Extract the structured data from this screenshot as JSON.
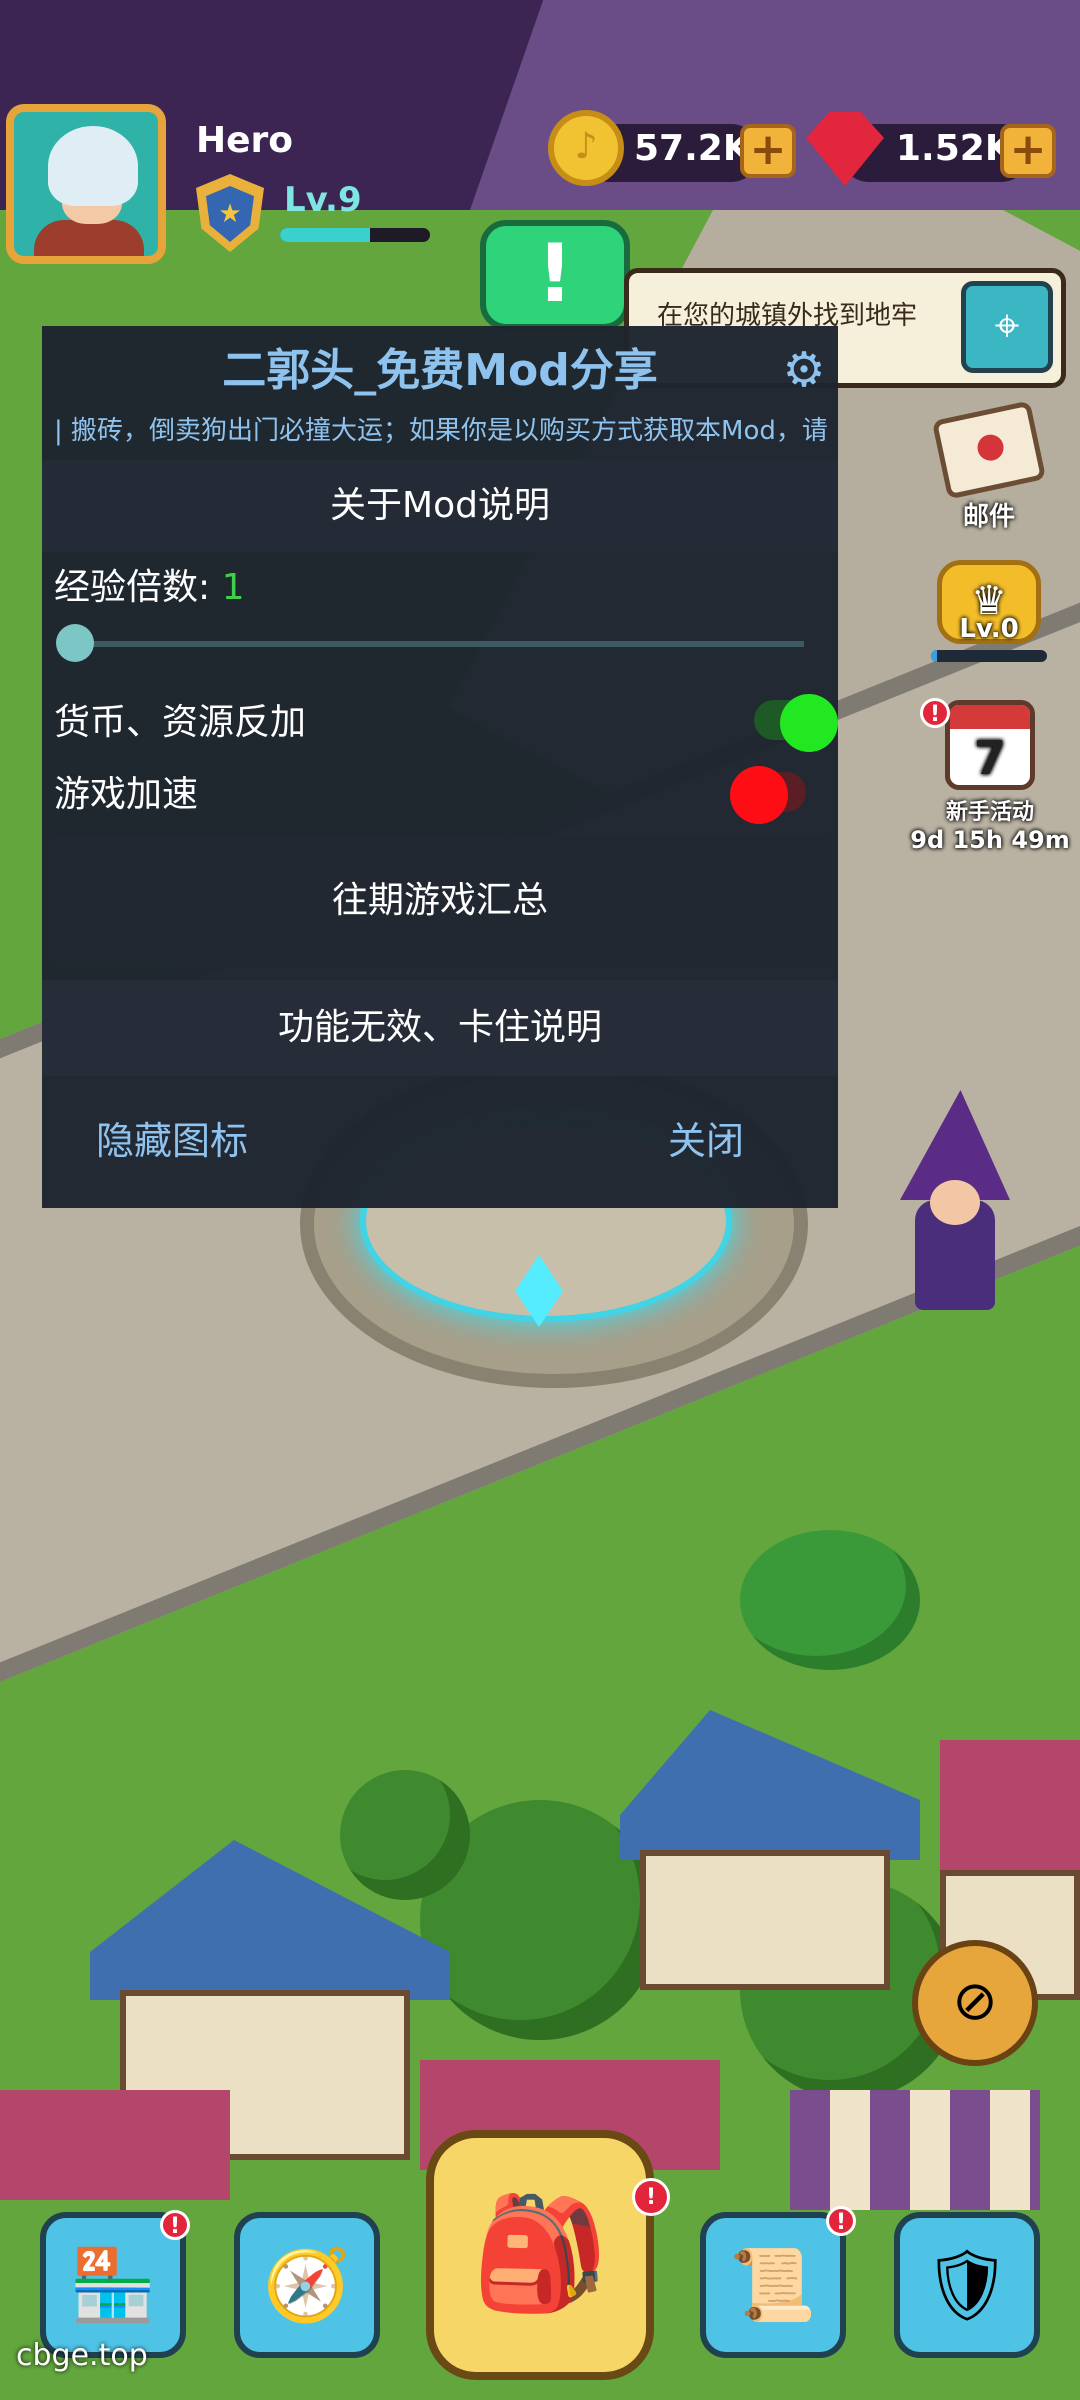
{
  "hud": {
    "player_name": "Hero",
    "level": "Lv.9",
    "level_progress": 0.6,
    "coins": "57.2K",
    "gems": "1.52K",
    "plus": "+",
    "alert_glyph": "!",
    "quest_text": "在您的城镇外找到地牢",
    "shield_glyph": "★",
    "coin_glyph": "♪",
    "map_glyph": "⌖"
  },
  "side": {
    "mail_label": "邮件",
    "crown_level": "Lv.0",
    "crown_glyph": "♛",
    "crown_progress": 0.05,
    "event_day": "7",
    "event_label": "新手活动",
    "event_timer": "9d 15h 49m",
    "badge": "!"
  },
  "mod": {
    "title": "二郭头_免费Mod分享",
    "gear_glyph": "⚙",
    "marquee": "| 搬砖，倒卖狗出门必撞大运；如果你是以购买方式获取本Mod，请",
    "about_button": "关于Mod说明",
    "exp_label": "经验倍数: ",
    "exp_value": "1",
    "exp_multiplier_value": 1,
    "toggle_currency": "货币、资源反加",
    "toggle_currency_on": true,
    "toggle_speed": "游戏加速",
    "toggle_speed_on": false,
    "games_button": "往期游戏汇总",
    "help_button": "功能无效、卡住说明",
    "hide_icon": "隐藏图标",
    "close": "关闭"
  },
  "nav": {
    "shop_glyph": "🏪",
    "compass_glyph": "🧭",
    "bag_glyph": "🎒",
    "quest_glyph": "📜",
    "guild_glyph": "🛡",
    "badge": "!"
  },
  "watermark": "cbge.top",
  "colors": {
    "accent_text": "#8fc3ef",
    "switch_on": "#22e822",
    "switch_off": "#ff0d14",
    "exp_value": "#3fcf4a"
  }
}
